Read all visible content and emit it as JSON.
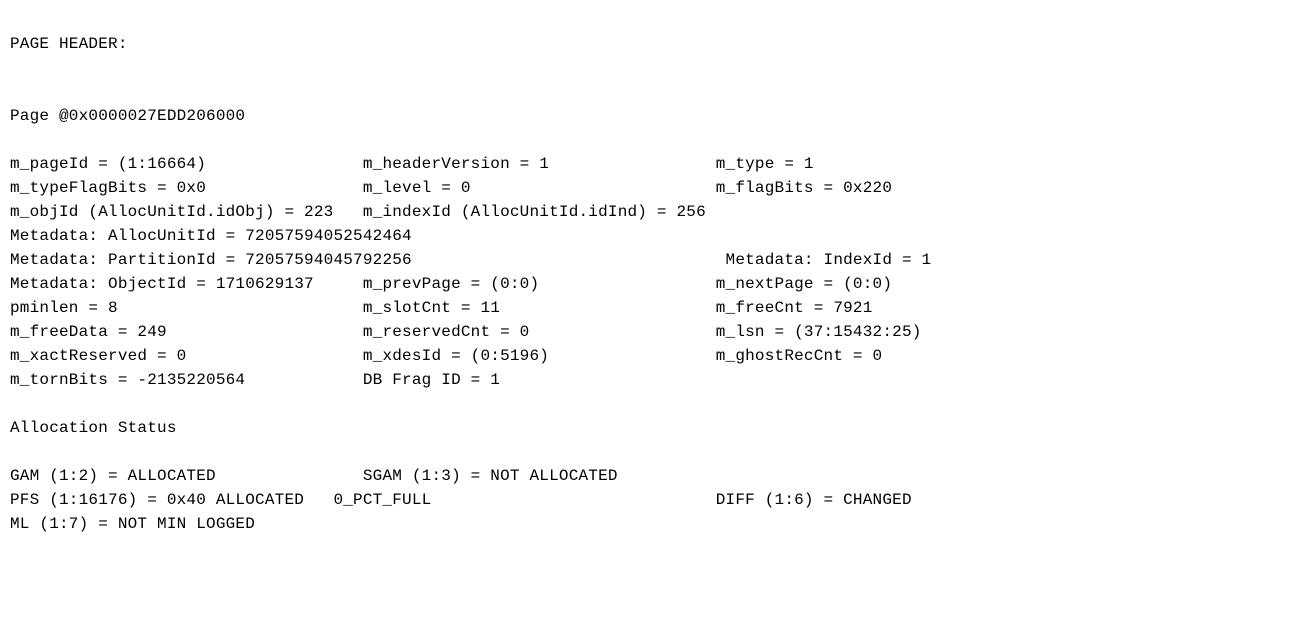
{
  "sections": {
    "page_header": "PAGE HEADER:",
    "allocation_status": "Allocation Status"
  },
  "header": {
    "page_address": "Page @0x0000027EDD206000",
    "m_pageId": "(1:16664)",
    "m_headerVersion": "1",
    "m_type": "1",
    "m_typeFlagBits": "0x0",
    "m_level": "0",
    "m_flagBits": "0x220",
    "m_objId": "223",
    "m_indexId": "256",
    "AllocUnitId": "72057594052542464",
    "PartitionId": "72057594045792256",
    "IndexId": "1",
    "ObjectId": "1710629137",
    "m_prevPage": "(0:0)",
    "m_nextPage": "(0:0)",
    "pminlen": "8",
    "m_slotCnt": "11",
    "m_freeCnt": "7921",
    "m_freeData": "249",
    "m_reservedCnt": "0",
    "m_lsn": "(37:15432:25)",
    "m_xactReserved": "0",
    "m_xdesId": "(0:5196)",
    "m_ghostRecCnt": "0",
    "m_tornBits": "-2135220564",
    "DB_Frag_ID": "1"
  },
  "allocation": {
    "GAM": "(1:2) = ALLOCATED",
    "SGAM": "(1:3) = NOT ALLOCATED",
    "PFS": "(1:16176) = 0x40 ALLOCATED   0_PCT_FULL",
    "DIFF": "(1:6) = CHANGED",
    "ML": "(1:7) = NOT MIN LOGGED"
  },
  "lines": {
    "page_addr": "Page @0x0000027EDD206000",
    "r1": "m_pageId = (1:16664)                m_headerVersion = 1                 m_type = 1",
    "r2": "m_typeFlagBits = 0x0                m_level = 0                         m_flagBits = 0x220",
    "r3": "m_objId (AllocUnitId.idObj) = 223   m_indexId (AllocUnitId.idInd) = 256 ",
    "r4": "Metadata: AllocUnitId = 72057594052542464                               ",
    "r5": "Metadata: PartitionId = 72057594045792256                                Metadata: IndexId = 1",
    "r6": "Metadata: ObjectId = 1710629137     m_prevPage = (0:0)                  m_nextPage = (0:0)",
    "r7": "pminlen = 8                         m_slotCnt = 11                      m_freeCnt = 7921",
    "r8": "m_freeData = 249                    m_reservedCnt = 0                   m_lsn = (37:15432:25)",
    "r9": "m_xactReserved = 0                  m_xdesId = (0:5196)                 m_ghostRecCnt = 0",
    "r10": "m_tornBits = -2135220564            DB Frag ID = 1                      ",
    "a1": "GAM (1:2) = ALLOCATED               SGAM (1:3) = NOT ALLOCATED          ",
    "a2": "PFS (1:16176) = 0x40 ALLOCATED   0_PCT_FULL                             DIFF (1:6) = CHANGED",
    "a3": "ML (1:7) = NOT MIN LOGGED           "
  }
}
